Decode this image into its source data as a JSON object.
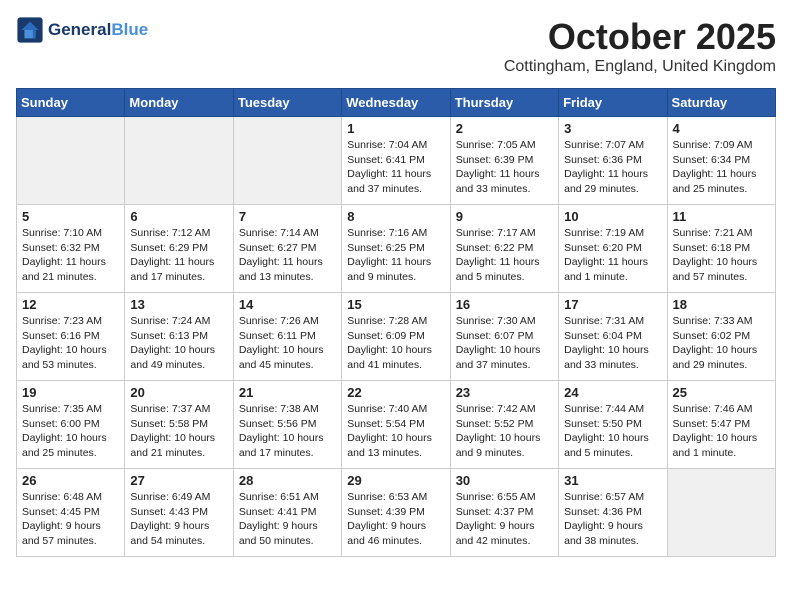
{
  "header": {
    "logo_line1": "General",
    "logo_line2": "Blue",
    "month_title": "October 2025",
    "location": "Cottingham, England, United Kingdom"
  },
  "weekdays": [
    "Sunday",
    "Monday",
    "Tuesday",
    "Wednesday",
    "Thursday",
    "Friday",
    "Saturday"
  ],
  "weeks": [
    [
      {
        "day": "",
        "info": ""
      },
      {
        "day": "",
        "info": ""
      },
      {
        "day": "",
        "info": ""
      },
      {
        "day": "1",
        "info": "Sunrise: 7:04 AM\nSunset: 6:41 PM\nDaylight: 11 hours\nand 37 minutes."
      },
      {
        "day": "2",
        "info": "Sunrise: 7:05 AM\nSunset: 6:39 PM\nDaylight: 11 hours\nand 33 minutes."
      },
      {
        "day": "3",
        "info": "Sunrise: 7:07 AM\nSunset: 6:36 PM\nDaylight: 11 hours\nand 29 minutes."
      },
      {
        "day": "4",
        "info": "Sunrise: 7:09 AM\nSunset: 6:34 PM\nDaylight: 11 hours\nand 25 minutes."
      }
    ],
    [
      {
        "day": "5",
        "info": "Sunrise: 7:10 AM\nSunset: 6:32 PM\nDaylight: 11 hours\nand 21 minutes."
      },
      {
        "day": "6",
        "info": "Sunrise: 7:12 AM\nSunset: 6:29 PM\nDaylight: 11 hours\nand 17 minutes."
      },
      {
        "day": "7",
        "info": "Sunrise: 7:14 AM\nSunset: 6:27 PM\nDaylight: 11 hours\nand 13 minutes."
      },
      {
        "day": "8",
        "info": "Sunrise: 7:16 AM\nSunset: 6:25 PM\nDaylight: 11 hours\nand 9 minutes."
      },
      {
        "day": "9",
        "info": "Sunrise: 7:17 AM\nSunset: 6:22 PM\nDaylight: 11 hours\nand 5 minutes."
      },
      {
        "day": "10",
        "info": "Sunrise: 7:19 AM\nSunset: 6:20 PM\nDaylight: 11 hours\nand 1 minute."
      },
      {
        "day": "11",
        "info": "Sunrise: 7:21 AM\nSunset: 6:18 PM\nDaylight: 10 hours\nand 57 minutes."
      }
    ],
    [
      {
        "day": "12",
        "info": "Sunrise: 7:23 AM\nSunset: 6:16 PM\nDaylight: 10 hours\nand 53 minutes."
      },
      {
        "day": "13",
        "info": "Sunrise: 7:24 AM\nSunset: 6:13 PM\nDaylight: 10 hours\nand 49 minutes."
      },
      {
        "day": "14",
        "info": "Sunrise: 7:26 AM\nSunset: 6:11 PM\nDaylight: 10 hours\nand 45 minutes."
      },
      {
        "day": "15",
        "info": "Sunrise: 7:28 AM\nSunset: 6:09 PM\nDaylight: 10 hours\nand 41 minutes."
      },
      {
        "day": "16",
        "info": "Sunrise: 7:30 AM\nSunset: 6:07 PM\nDaylight: 10 hours\nand 37 minutes."
      },
      {
        "day": "17",
        "info": "Sunrise: 7:31 AM\nSunset: 6:04 PM\nDaylight: 10 hours\nand 33 minutes."
      },
      {
        "day": "18",
        "info": "Sunrise: 7:33 AM\nSunset: 6:02 PM\nDaylight: 10 hours\nand 29 minutes."
      }
    ],
    [
      {
        "day": "19",
        "info": "Sunrise: 7:35 AM\nSunset: 6:00 PM\nDaylight: 10 hours\nand 25 minutes."
      },
      {
        "day": "20",
        "info": "Sunrise: 7:37 AM\nSunset: 5:58 PM\nDaylight: 10 hours\nand 21 minutes."
      },
      {
        "day": "21",
        "info": "Sunrise: 7:38 AM\nSunset: 5:56 PM\nDaylight: 10 hours\nand 17 minutes."
      },
      {
        "day": "22",
        "info": "Sunrise: 7:40 AM\nSunset: 5:54 PM\nDaylight: 10 hours\nand 13 minutes."
      },
      {
        "day": "23",
        "info": "Sunrise: 7:42 AM\nSunset: 5:52 PM\nDaylight: 10 hours\nand 9 minutes."
      },
      {
        "day": "24",
        "info": "Sunrise: 7:44 AM\nSunset: 5:50 PM\nDaylight: 10 hours\nand 5 minutes."
      },
      {
        "day": "25",
        "info": "Sunrise: 7:46 AM\nSunset: 5:47 PM\nDaylight: 10 hours\nand 1 minute."
      }
    ],
    [
      {
        "day": "26",
        "info": "Sunrise: 6:48 AM\nSunset: 4:45 PM\nDaylight: 9 hours\nand 57 minutes."
      },
      {
        "day": "27",
        "info": "Sunrise: 6:49 AM\nSunset: 4:43 PM\nDaylight: 9 hours\nand 54 minutes."
      },
      {
        "day": "28",
        "info": "Sunrise: 6:51 AM\nSunset: 4:41 PM\nDaylight: 9 hours\nand 50 minutes."
      },
      {
        "day": "29",
        "info": "Sunrise: 6:53 AM\nSunset: 4:39 PM\nDaylight: 9 hours\nand 46 minutes."
      },
      {
        "day": "30",
        "info": "Sunrise: 6:55 AM\nSunset: 4:37 PM\nDaylight: 9 hours\nand 42 minutes."
      },
      {
        "day": "31",
        "info": "Sunrise: 6:57 AM\nSunset: 4:36 PM\nDaylight: 9 hours\nand 38 minutes."
      },
      {
        "day": "",
        "info": ""
      }
    ]
  ]
}
